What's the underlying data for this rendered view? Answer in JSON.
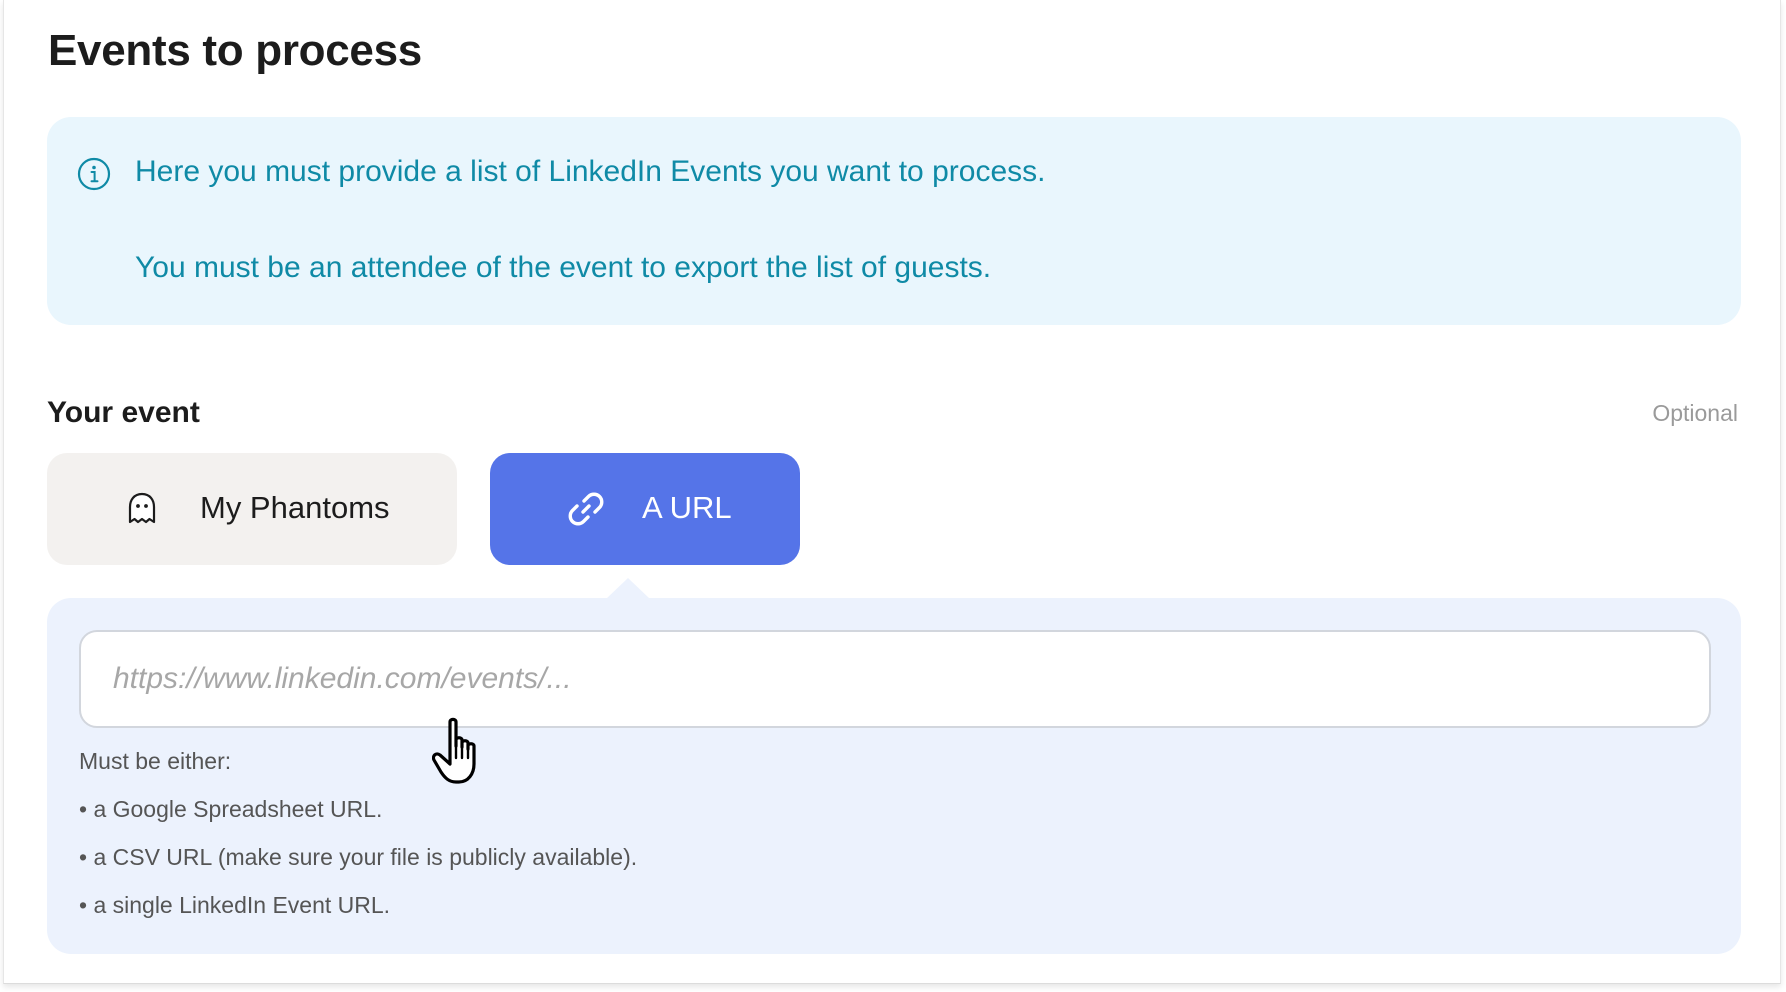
{
  "header": {
    "title": "Events to process"
  },
  "info": {
    "icon": "info-icon",
    "line1": "Here you must provide a list of LinkedIn Events you want to process.",
    "line2": "You must be an attendee of the event to export the list of guests.",
    "color": "#0f8aa6",
    "background": "#e9f6fd"
  },
  "event_section": {
    "label": "Your event",
    "optional": "Optional",
    "tabs": [
      {
        "label": "My Phantoms",
        "icon": "ghost-icon",
        "selected": false
      },
      {
        "label": "A URL",
        "icon": "link-icon",
        "selected": true
      }
    ],
    "accent": "#5574e8",
    "input": {
      "value": "",
      "placeholder": "https://www.linkedin.com/events/..."
    },
    "hints": [
      "Must be either:",
      "• a Google Spreadsheet URL.",
      "• a CSV URL (make sure your file is publicly available).",
      "• a single LinkedIn Event URL."
    ]
  },
  "cursor": {
    "icon": "hand-pointer-icon"
  }
}
